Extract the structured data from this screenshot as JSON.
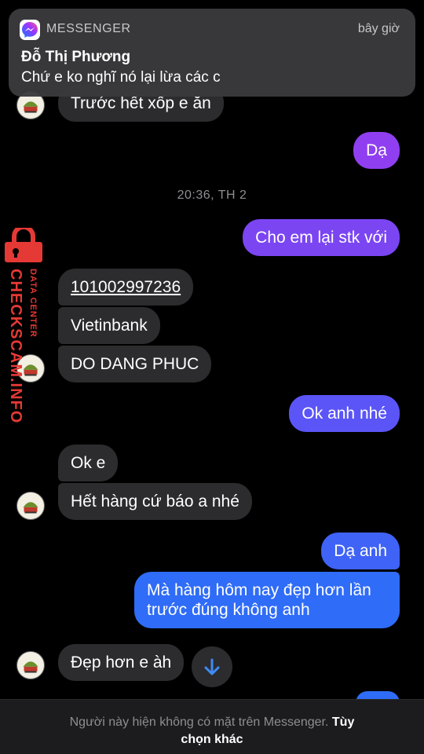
{
  "notification": {
    "app_name": "MESSENGER",
    "time": "bây giờ",
    "sender": "Đỗ Thị Phương",
    "preview": "Chứ e ko nghĩ nó lại lừa các c"
  },
  "watermark": {
    "main": "CHECKSCAM.INFO",
    "sub": "DATA CENTER"
  },
  "messages": {
    "m0": "Trước hết xốp e ăn",
    "m1": "Dạ",
    "timestamp": "20:36, TH 2",
    "m2": "Cho em lại stk với",
    "m3": "101002997236",
    "m4": "Vietinbank",
    "m5": "DO DANG PHUC",
    "m6": "Ok anh nhé",
    "m7": "Ok e",
    "m8": "Hết hàng cứ báo a nhé",
    "m9": "Dạ anh",
    "m10": "Mà hàng hôm nay đẹp hơn lần",
    "m10b": "trước đúng không anh",
    "m11": "Đẹp hơn e àh"
  },
  "footer": {
    "text": "Người này hiện không có mặt trên Messenger.",
    "link_part1": "Tùy",
    "link_part2": "chọn khác"
  },
  "colors": {
    "outgoing_top": "#8f3ff0",
    "outgoing_mid": "#5b55f7",
    "outgoing_bottom": "#2f6cf7",
    "incoming": "#2c2c2e",
    "watermark": "#e53935"
  },
  "icons": [
    "messenger-logo-icon",
    "avatar-image",
    "lock-icon",
    "arrow-down-icon"
  ]
}
